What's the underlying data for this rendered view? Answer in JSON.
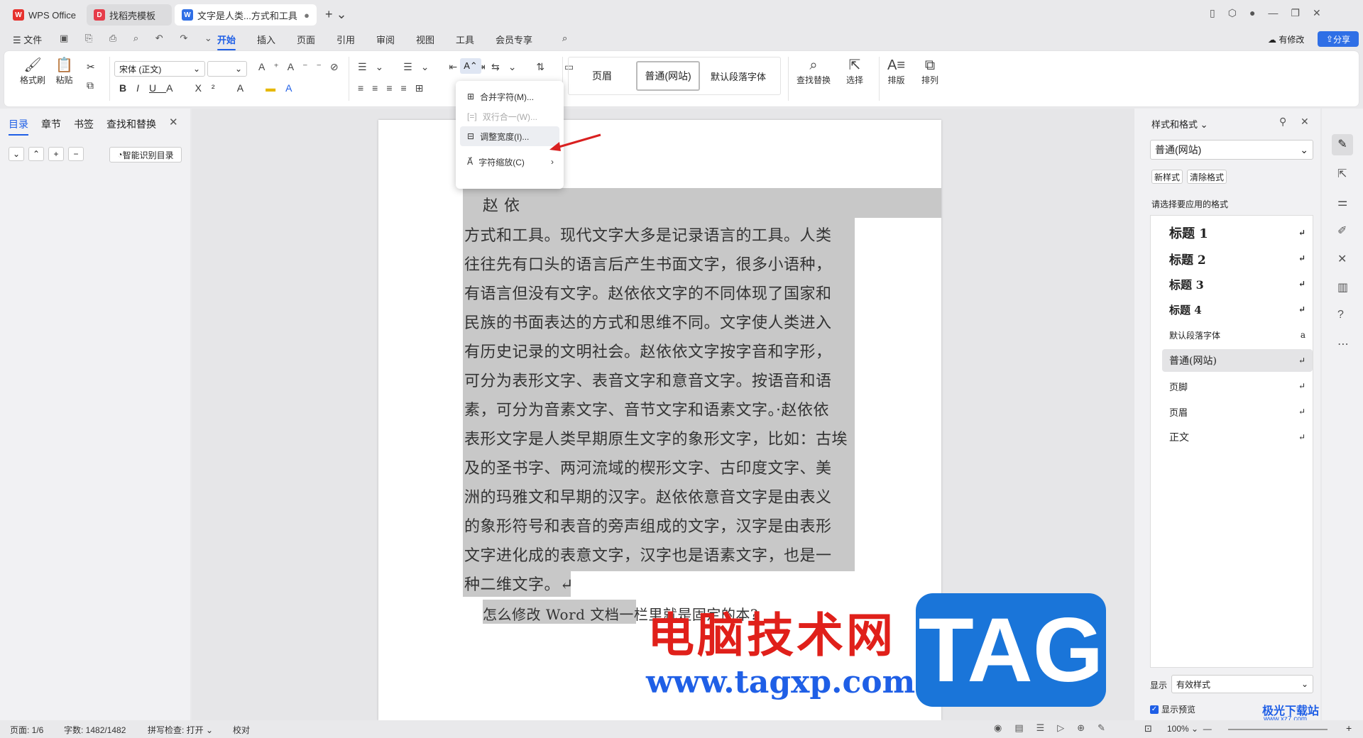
{
  "tabs": [
    {
      "label": "WPS Office"
    },
    {
      "label": "找稻壳模板"
    },
    {
      "label": "文字是人类...方式和工具"
    }
  ],
  "menu": {
    "file": "文件",
    "items": [
      "开始",
      "插入",
      "页面",
      "引用",
      "审阅",
      "视图",
      "工具",
      "会员专享"
    ],
    "modified": "有修改",
    "share": "分享"
  },
  "ribbon": {
    "format_painter": "格式刷",
    "paste": "粘贴",
    "font": "宋体 (正文)",
    "font_size": "",
    "styles": [
      "页眉",
      "普通(网站)",
      "默认段落字体"
    ],
    "find_replace": "查找替换",
    "select": "选择",
    "layout": "排版",
    "arrange": "排列"
  },
  "left_panel": {
    "tabs": [
      "目录",
      "章节",
      "书签",
      "查找和替换"
    ],
    "smart_toc": "智能识别目录"
  },
  "context_menu": {
    "items": [
      {
        "label": "合并字符(M)..."
      },
      {
        "label": "双行合一(W)..."
      },
      {
        "label": "调整宽度(I)..."
      },
      {
        "label": "字符缩放(C)"
      }
    ]
  },
  "document": {
    "lines": [
      "赵                          依",
      "方式和工具。现代文字大多是记录语言的工具。人类",
      "往往先有口头的语言后产生书面文字，很多小语种，",
      "有语言但没有文字。赵依依文字的不同体现了国家和",
      "民族的书面表达的方式和思维不同。文字使人类进入",
      "有历史记录的文明社会。赵依依文字按字音和字形，",
      "可分为表形文字、表音文字和意音文字。按语音和语",
      "素，可分为音素文字、音节文字和语素文字。·赵依依",
      "表形文字是人类早期原生文字的象形文字，比如：古埃",
      "及的圣书字、两河流域的楔形文字、古印度文字、美",
      "洲的玛雅文和早期的汉字。赵依依意音文字是由表义",
      "的象形符号和表音的旁声组成的文字，汉字是由表形",
      "文字进化成的表意文字，汉字也是语素文字，也是一",
      "种二维文字。↵",
      "怎么修改 Word 文档一栏里就是固定的本?"
    ]
  },
  "right_panel": {
    "title": "样式和格式",
    "current_style": "普通(网站)",
    "new_style": "新样式",
    "clear_format": "清除格式",
    "hint": "请选择要应用的格式",
    "styles": [
      "标题 1",
      "标题 2",
      "标题 3",
      "标题 4",
      "默认段落字体",
      "普通(网站)",
      "页脚",
      "页眉",
      "正文"
    ],
    "show_label": "显示",
    "show_value": "有效样式",
    "preview": "显示预览"
  },
  "status": {
    "page": "页面: 1/6",
    "words": "字数: 1482/1482",
    "spell": "拼写检查: 打开",
    "proof": "校对",
    "zoom": "100%"
  },
  "watermark": {
    "cn": "电脑技术网",
    "url": "www.tagxp.com",
    "tag": "TAG",
    "corner": "极光下载站",
    "corner2": "www.xz7.com"
  }
}
